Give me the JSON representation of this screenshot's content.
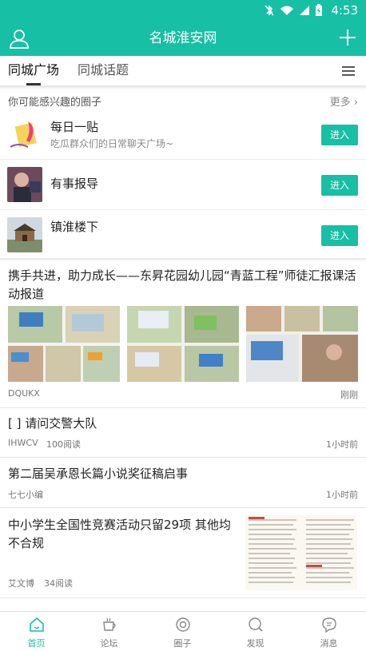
{
  "statusbar": {
    "time": "4:53"
  },
  "header": {
    "title": "名城淮安网"
  },
  "tabs": [
    {
      "label": "同城广场"
    },
    {
      "label": "同城话题"
    }
  ],
  "circles": {
    "heading": "你可能感兴趣的圈子",
    "more": "更多",
    "items": [
      {
        "name": "每日一贴",
        "desc": "吃瓜群众们的日常聊天广场~",
        "join": "进入"
      },
      {
        "name": "有事报导",
        "desc": "",
        "join": "进入"
      },
      {
        "name": "镇淮楼下",
        "desc": "",
        "join": "进入"
      }
    ]
  },
  "posts": [
    {
      "title": "携手共进，助力成长——东昇花园幼儿园“青蓝工程”师徒汇报课活动报道",
      "author": "DQUKX",
      "reads": "",
      "time": "刚刚"
    },
    {
      "title": "[ ] 请问交警大队",
      "author": "IHWCV",
      "reads": "100阅读",
      "time": "1小时前"
    },
    {
      "title": "第二届吴承恩长篇小说奖征稿启事",
      "author": "七七小编",
      "reads": "",
      "time": "1小时前"
    },
    {
      "title": "中小学生全国性竞赛活动只留29项 其他均不合规",
      "author": "艾文博",
      "reads": "34阅读",
      "time": "1小时前"
    }
  ],
  "bottomnav": [
    {
      "label": "首页",
      "icon": "home-icon"
    },
    {
      "label": "论坛",
      "icon": "cup-icon"
    },
    {
      "label": "圈子",
      "icon": "circle-icon"
    },
    {
      "label": "发现",
      "icon": "discover-icon"
    },
    {
      "label": "消息",
      "icon": "message-icon"
    }
  ],
  "colors": {
    "accent": "#17bfa4"
  }
}
